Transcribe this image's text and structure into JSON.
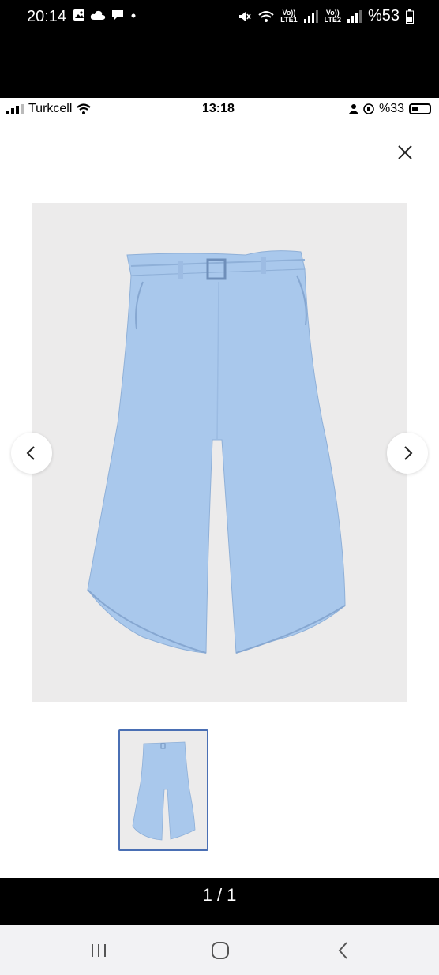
{
  "outer_status": {
    "time": "20:14",
    "battery_text": "%53",
    "sim1_label_top": "Vo))",
    "sim1_label_bottom": "LTE1",
    "sim2_label_top": "Vo))",
    "sim2_label_bottom": "LTE2"
  },
  "inner_status": {
    "carrier": "Turkcell",
    "time": "13:18",
    "battery_text": "%33"
  },
  "gallery": {
    "counter": "1 / 1",
    "product_color": "#a9c8ec"
  }
}
